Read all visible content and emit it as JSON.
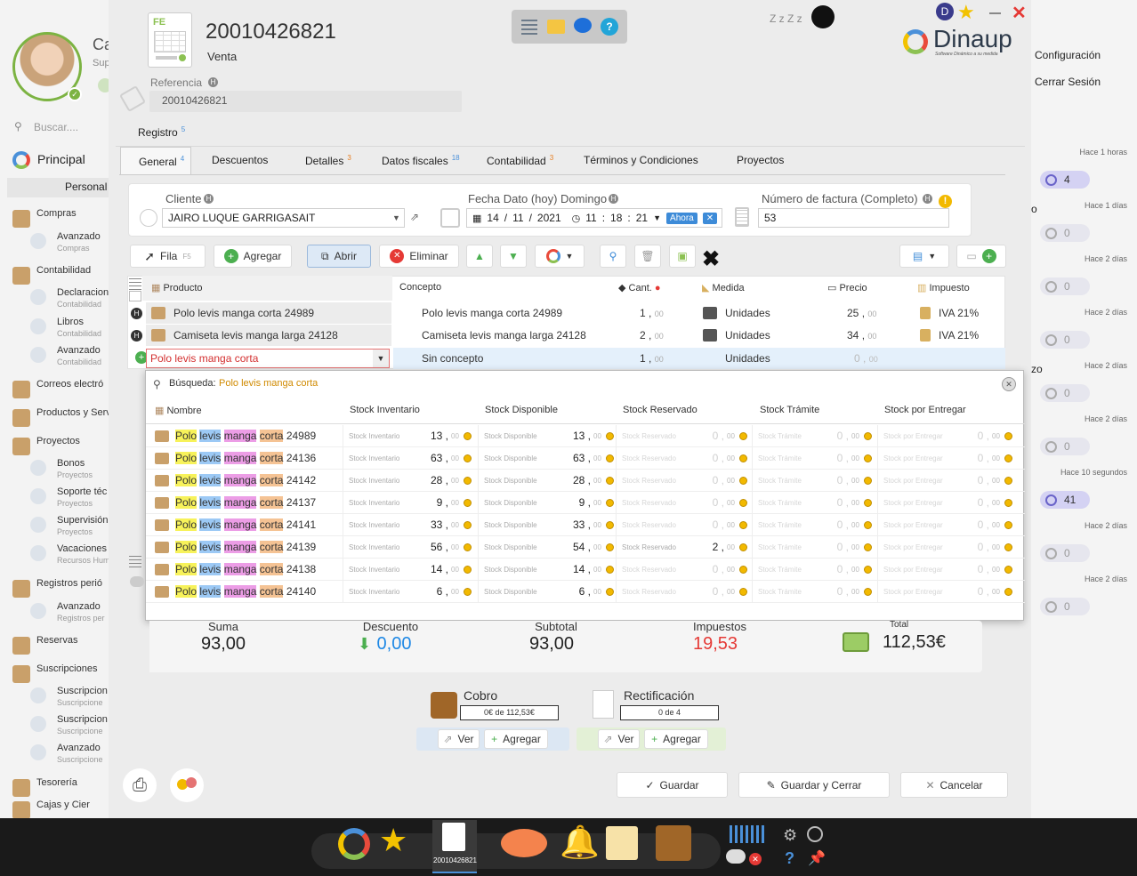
{
  "sidebar": {
    "name_cut": "Ca",
    "role_cut": "Sup",
    "search_placeholder": "Buscar....",
    "principal": "Principal",
    "personal": "Personal",
    "items": [
      {
        "label": "Compras"
      },
      {
        "label": "Avanzado",
        "sub": "Compras"
      },
      {
        "label": "Contabilidad"
      },
      {
        "label": "Declaracion",
        "sub": "Contabilidad"
      },
      {
        "label": "Libros",
        "sub": "Contabilidad"
      },
      {
        "label": "Avanzado",
        "sub": "Contabilidad"
      },
      {
        "label": "Correos electró"
      },
      {
        "label": "Productos y Serv"
      },
      {
        "label": "Proyectos"
      },
      {
        "label": "Bonos",
        "sub": "Proyectos"
      },
      {
        "label": "Soporte téc",
        "sub": "Proyectos"
      },
      {
        "label": "Supervisión",
        "sub": "Proyectos"
      },
      {
        "label": "Vacaciones y Fe",
        "sub": "Recursos Human"
      },
      {
        "label": "Registros perió"
      },
      {
        "label": "Avanzado",
        "sub": "Registros per"
      },
      {
        "label": "Reservas"
      },
      {
        "label": "Suscripciones"
      },
      {
        "label": "Suscripcion",
        "sub": "Suscripcione"
      },
      {
        "label": "Suscripcion",
        "sub": "Suscripcione"
      },
      {
        "label": "Avanzado",
        "sub": "Suscripcione"
      },
      {
        "label": "Tesorería"
      },
      {
        "label": "Cajas y Cier"
      }
    ]
  },
  "doc": {
    "number": "20010426821",
    "type": "Venta",
    "ref_label": "Referencia",
    "ref_value": "20010426821",
    "fe_badge": "FE"
  },
  "brand": {
    "name": "Dinaup",
    "tagline": "Software Dinámico a su medida",
    "user_initial": "D",
    "zzz": "Z z Z z"
  },
  "tabs": {
    "registro": "Registro",
    "registro_count": "5",
    "items": [
      {
        "label": "General",
        "count": "4"
      },
      {
        "label": "Descuentos",
        "count": ""
      },
      {
        "label": "Detalles",
        "count": "3"
      },
      {
        "label": "Datos fiscales",
        "count": "18"
      },
      {
        "label": "Contabilidad",
        "count": "3"
      },
      {
        "label": "Términos y Condiciones",
        "count": ""
      },
      {
        "label": "Proyectos",
        "count": ""
      }
    ]
  },
  "form": {
    "cliente_label": "Cliente",
    "cliente_value": "JAIRO LUQUE GARRIGASAIT",
    "fecha_label": "Fecha Dato (hoy) Domingo",
    "fecha_day": "14",
    "fecha_month": "11",
    "fecha_year": "2021",
    "hora_h": "11",
    "hora_m": "18",
    "hora_s": "21",
    "ahora": "Ahora",
    "factura_label": "Número de factura (Completo)",
    "factura_value": "53"
  },
  "toolbar": {
    "fila": "Fila",
    "fila_key": "F5",
    "agregar": "Agregar",
    "abrir": "Abrir",
    "eliminar": "Eliminar"
  },
  "grid": {
    "headers": {
      "producto": "Producto",
      "concepto": "Concepto",
      "cant": "Cant.",
      "medida": "Medida",
      "precio": "Precio",
      "impuesto": "Impuesto"
    },
    "rows": [
      {
        "producto": "Polo levis manga corta 24989",
        "concepto": "Polo levis manga corta 24989",
        "cant": "1",
        "cant_dec": "00",
        "medida": "Unidades",
        "precio": "25",
        "precio_dec": "00",
        "impuesto": "IVA 21%"
      },
      {
        "producto": "Camiseta levis manga larga 24128",
        "concepto": "Camiseta levis manga larga 24128",
        "cant": "2",
        "cant_dec": "00",
        "medida": "Unidades",
        "precio": "34",
        "precio_dec": "00",
        "impuesto": "IVA 21%"
      }
    ],
    "edit_row": {
      "producto": "Polo levis manga corta",
      "concepto": "Sin concepto",
      "cant": "1",
      "cant_dec": "00",
      "medida": "Unidades",
      "precio": "0",
      "precio_dec": "00"
    }
  },
  "search": {
    "label": "Búsqueda:",
    "query": "Polo levis manga corta",
    "headers": {
      "nombre": "Nombre",
      "inv": "Stock Inventario",
      "disp": "Stock Disponible",
      "res": "Stock Reservado",
      "tram": "Stock Trámite",
      "ent": "Stock por Entregar"
    },
    "hl": {
      "w1": "Polo",
      "w2": "levis",
      "w3": "manga",
      "w4": "corta"
    },
    "rows": [
      {
        "code": "24989",
        "inv": "13",
        "disp": "13",
        "res": "0",
        "tram": "0",
        "ent": "0"
      },
      {
        "code": "24136",
        "inv": "63",
        "disp": "63",
        "res": "0",
        "tram": "0",
        "ent": "0"
      },
      {
        "code": "24142",
        "inv": "28",
        "disp": "28",
        "res": "0",
        "tram": "0",
        "ent": "0"
      },
      {
        "code": "24137",
        "inv": "9",
        "disp": "9",
        "res": "0",
        "tram": "0",
        "ent": "0"
      },
      {
        "code": "24141",
        "inv": "33",
        "disp": "33",
        "res": "0",
        "tram": "0",
        "ent": "0"
      },
      {
        "code": "24139",
        "inv": "56",
        "disp": "54",
        "res": "2",
        "tram": "0",
        "ent": "0"
      },
      {
        "code": "24138",
        "inv": "14",
        "disp": "14",
        "res": "0",
        "tram": "0",
        "ent": "0"
      },
      {
        "code": "24140",
        "inv": "6",
        "disp": "6",
        "res": "0",
        "tram": "0",
        "ent": "0"
      }
    ],
    "dec": "00"
  },
  "totals": {
    "suma_label": "Suma",
    "suma": "93,00",
    "desc_label": "Descuento",
    "desc": "0,00",
    "sub_label": "Subtotal",
    "sub": "93,00",
    "imp_label": "Impuestos",
    "imp": "19,53",
    "total_label": "Total",
    "total": "112,53€"
  },
  "cobro": {
    "label": "Cobro",
    "progress": "0€ de 112,53€",
    "ver": "Ver",
    "agregar": "Agregar"
  },
  "rect": {
    "label": "Rectificación",
    "progress": "0 de 4",
    "ver": "Ver",
    "agregar": "Agregar"
  },
  "actions": {
    "guardar": "Guardar",
    "guardar_cerrar": "Guardar y Cerrar",
    "cancelar": "Cancelar"
  },
  "rightpanel": {
    "configuracion": "Configuración",
    "cerrar": "Cerrar Sesión",
    "o": "o",
    "zo": "zo",
    "notes": [
      {
        "time": "Hace 1 horas",
        "count": "4",
        "active": true
      },
      {
        "time": "Hace 1 días",
        "count": "0",
        "active": false
      },
      {
        "time": "Hace 2 días",
        "count": "0",
        "active": false
      },
      {
        "time": "Hace 2 días",
        "count": "0",
        "active": false
      },
      {
        "time": "Hace 2 días",
        "count": "0",
        "active": false
      },
      {
        "time": "Hace 2 días",
        "count": "0",
        "active": false
      },
      {
        "time": "Hace 10 segundos",
        "count": "41",
        "active": true
      },
      {
        "time": "Hace 2 días",
        "count": "0",
        "active": false
      },
      {
        "time": "Hace 2 días",
        "count": "0",
        "active": false
      }
    ]
  },
  "taskbar": {
    "doc_label": "20010426821"
  },
  "colors": {
    "accent_green": "#8cc152",
    "imp_red": "#e53935",
    "desc_blue": "#1e88e5",
    "purple": "#6a64c9"
  }
}
